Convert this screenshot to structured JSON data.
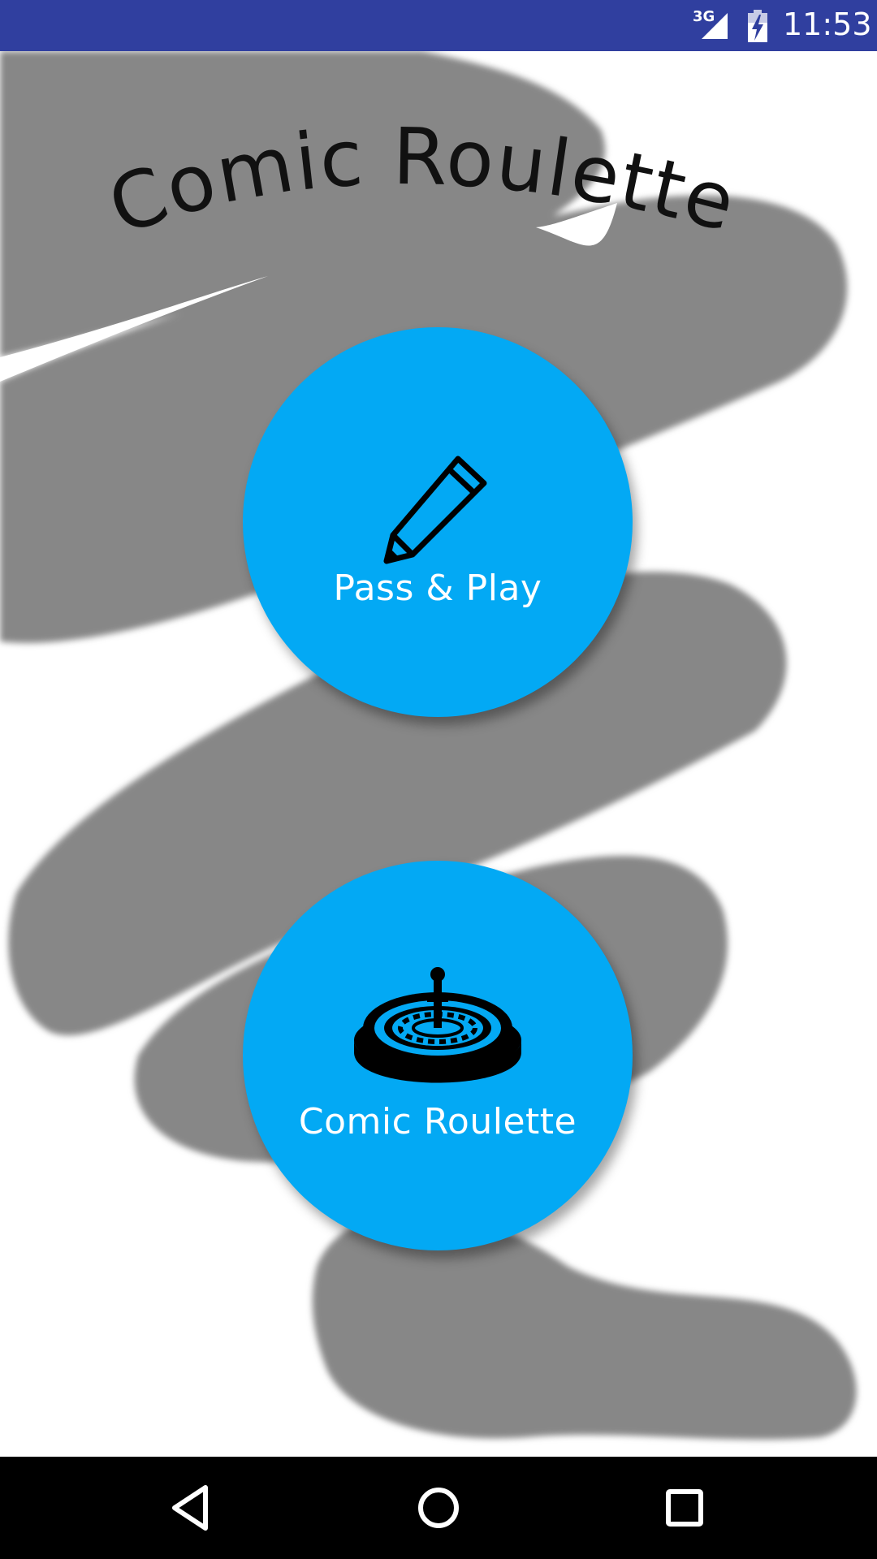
{
  "status_bar": {
    "network_label": "3G",
    "time": "11:53",
    "background_color": "#303f9f"
  },
  "app": {
    "title": "Comic Roulette",
    "accent_color": "#03a9f4",
    "scribble_color": "#878787"
  },
  "menu": {
    "pass_and_play": {
      "label": "Pass & Play",
      "icon": "pencil-icon"
    },
    "comic_roulette": {
      "label": "Comic Roulette",
      "icon": "roulette-wheel-icon"
    }
  },
  "nav_bar": {
    "back_icon": "back-triangle-icon",
    "home_icon": "home-circle-icon",
    "recents_icon": "recents-square-icon"
  }
}
